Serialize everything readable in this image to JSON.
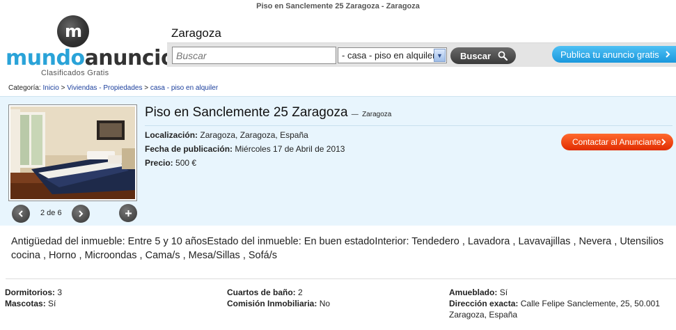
{
  "page_title": "Piso en Sanclemente 25 Zaragoza - Zaragoza",
  "logo": {
    "word_a": "mundo",
    "word_b": "anuncio",
    "tagline": "Clasificados Gratis",
    "mark": "m"
  },
  "header": {
    "city": "Zaragoza"
  },
  "search": {
    "placeholder": "Buscar",
    "category_selected": "- casa - piso en alquiler",
    "button_label": "Buscar"
  },
  "publish_label": "Publica tu anuncio gratis",
  "breadcrumb": {
    "prefix": "Categoría:",
    "items": [
      "Inicio",
      "Viviendas - Propiedades",
      "casa - piso en alquiler"
    ],
    "separator": ">"
  },
  "listing": {
    "title": "Piso en Sanclemente 25 Zaragoza",
    "dash": "—",
    "city": "Zaragoza",
    "location_label": "Localización:",
    "location_value": "Zaragoza, Zaragoza, España",
    "date_label": "Fecha de publicación:",
    "date_value": "Miércoles 17 de Abril de 2013",
    "price_label": "Precio:",
    "price_value": "500 €",
    "contact_label": "Contactar al Anunciante",
    "photo_counter": "2 de 6"
  },
  "description": "Antigüedad del inmueble: Entre 5 y 10 añosEstado del inmueble: En buen estadoInterior: Tendedero , Lavadora , Lavavajillas , Nevera , Utensilios cocina , Horno , Microondas , Cama/s , Mesa/Sillas , Sofá/s",
  "attributes": {
    "bedrooms_label": "Dormitorios:",
    "bedrooms_value": "3",
    "pets_label": "Mascotas:",
    "pets_value": "Sí",
    "bathrooms_label": "Cuartos de baño:",
    "bathrooms_value": "2",
    "commission_label": "Comisión Inmobiliaria:",
    "commission_value": "No",
    "furnished_label": "Amueblado:",
    "furnished_value": "Sí",
    "address_label": "Dirección exacta:",
    "address_value": "Calle Felipe Sanclemente, 25, 50.001 Zaragoza, España"
  },
  "colors": {
    "accent_blue": "#2aa3d8",
    "panel_bg": "#e8f5fd",
    "contact_orange": "#e12c00",
    "publish_blue": "#1a98dd",
    "link": "#1a3e9c"
  },
  "icons": {
    "search_button": "magnifier-icon",
    "publish": "chevron-right-icon",
    "contact": "chevron-right-icon",
    "prev": "chevron-left-icon",
    "next": "chevron-right-icon",
    "zoom": "plus-icon"
  }
}
